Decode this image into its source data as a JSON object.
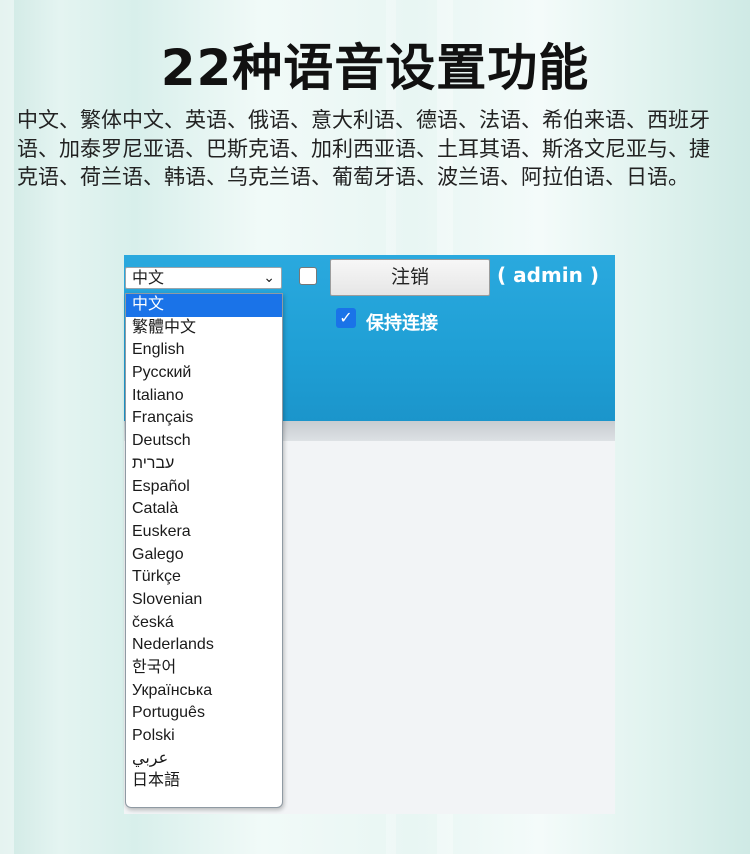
{
  "heading": "22种语音设置功能",
  "description": "中文、繁体中文、英语、俄语、意大利语、德语、法语、希伯来语、西班牙语、加泰罗尼亚语、巴斯克语、加利西亚语、土耳其语、斯洛文尼亚与、捷克语、荷兰语、韩语、乌克兰语、葡萄牙语、波兰语、阿拉伯语、日语。",
  "toolbar": {
    "language_selected": "中文",
    "logout_label": "注销",
    "user_label": "( admin )",
    "keep_connected_label": "保持连接",
    "keep_connected_checked": true,
    "checkbox_a_checked": false
  },
  "dropdown": {
    "options": [
      "中文",
      "繁體中文",
      "English",
      "Русский",
      "Italiano",
      "Français",
      "Deutsch",
      "עברית",
      "Español",
      "Català",
      "Euskera",
      "Galego",
      "Türkçe",
      "Slovenian",
      "česká",
      "Nederlands",
      "한국어",
      "Українська",
      "Português",
      "Polski",
      "عربي",
      "日本語"
    ],
    "selected_index": 0
  },
  "colors": {
    "header_blue": "#22a3da",
    "selection_blue": "#1a73e8"
  }
}
